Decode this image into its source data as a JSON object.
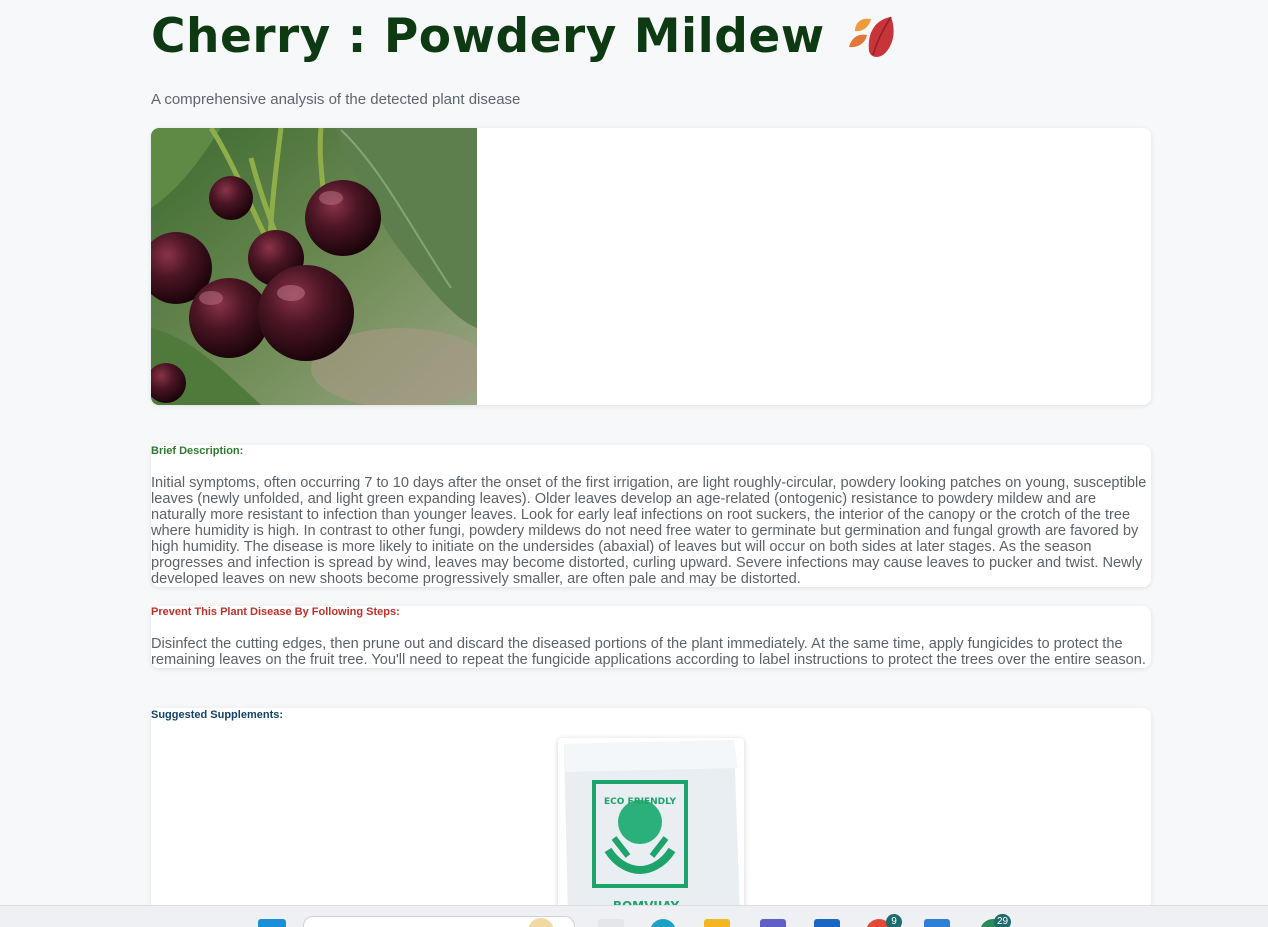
{
  "header": {
    "title": "Cherry : Powdery Mildew",
    "title_icon": "autumn-leaves-icon",
    "subtitle": "A comprehensive analysis of the detected plant disease"
  },
  "brief": {
    "heading": "Brief Description:",
    "text": "Initial symptoms, often occurring 7 to 10 days after the onset of the first irrigation, are light roughly-circular, powdery looking patches on young, susceptible leaves (newly unfolded, and light green expanding leaves). Older leaves develop an age-related (ontogenic) resistance to powdery mildew and are naturally more resistant to infection than younger leaves. Look for early leaf infections on root suckers, the interior of the canopy or the crotch of the tree where humidity is high. In contrast to other fungi, powdery mildews do not need free water to germinate but germination and fungal growth are favored by high humidity. The disease is more likely to initiate on the undersides (abaxial) of leaves but will occur on both sides at later stages. As the season progresses and infection is spread by wind, leaves may become distorted, curling upward. Severe infections may cause leaves to pucker and twist. Newly developed leaves on new shoots become progressively smaller, are often pale and may be distorted."
  },
  "prevent": {
    "heading": "Prevent This Plant Disease By Following Steps:",
    "text": "Disinfect the cutting edges, then prune out and discard the diseased portions of the plant immediately. At the same time, apply fungicides to protect the remaining leaves on the fruit tree. You'll need to repeat the fungicide applications according to label instructions to protect the trees over the entire season."
  },
  "supplements": {
    "heading": "Suggested Supplements:",
    "product_logo_text": "ECO FRIENDLY",
    "product_brand": "BOMVIJAY"
  },
  "taskbar": {
    "badges": [
      "9",
      "29"
    ]
  },
  "colors": {
    "title": "#0d3a12",
    "brief_heading": "#2f7a32",
    "prevent_heading": "#c0302b",
    "supplements_heading": "#12436b",
    "page_bg": "#f6f8fa"
  }
}
